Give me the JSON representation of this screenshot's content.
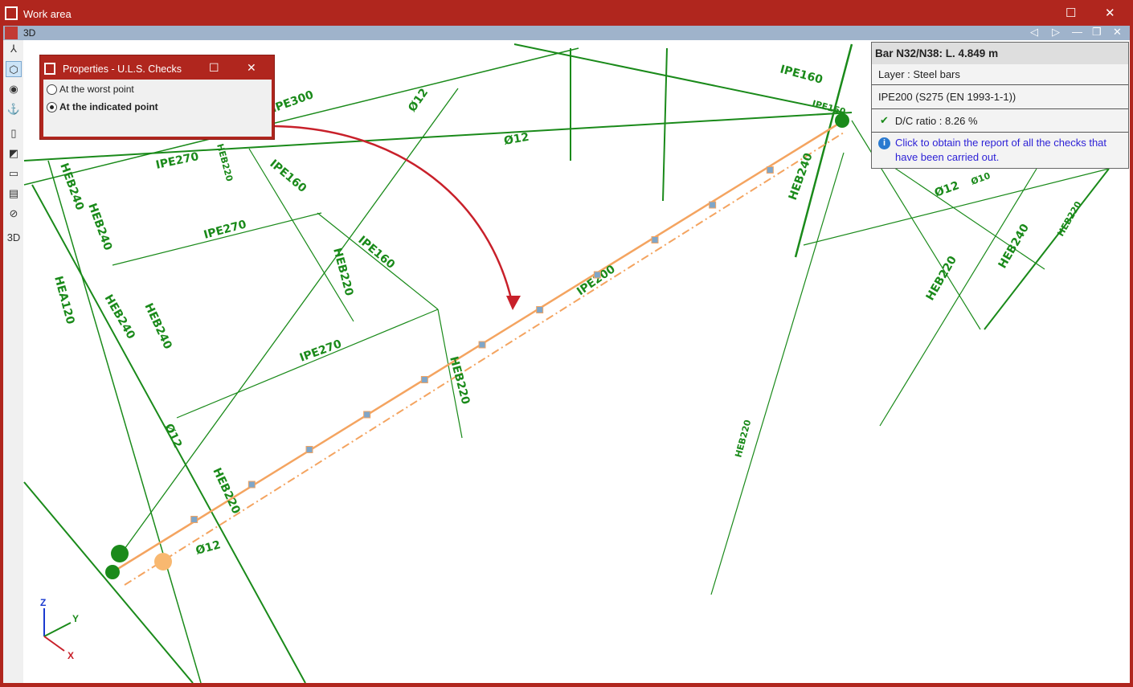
{
  "window": {
    "title": "Work area",
    "maximize": "☐",
    "close": "✕"
  },
  "tab": {
    "name": "3D",
    "prev": "◁",
    "next": "▷",
    "minimize": "—",
    "restore": "❐",
    "close": "✕"
  },
  "toolbar": [
    {
      "icon": "axes-icon",
      "g": "⅄"
    },
    {
      "icon": "cube-view-icon",
      "g": "⬡"
    },
    {
      "icon": "orbit-icon",
      "g": "◉"
    },
    {
      "icon": "rotate-icon",
      "g": "⚓"
    },
    {
      "icon": "section-icon",
      "g": "▯"
    },
    {
      "icon": "plane-icon",
      "g": "◩"
    },
    {
      "icon": "frame-icon",
      "g": "▭"
    },
    {
      "icon": "layers-icon",
      "g": "▤"
    },
    {
      "icon": "hide-icon",
      "g": "⊘"
    },
    {
      "icon": "3d-settings-icon",
      "g": "3D"
    }
  ],
  "properties": {
    "title": "Properties - U.L.S. Checks",
    "options": [
      {
        "label": "At the worst point",
        "selected": false
      },
      {
        "label": "At the indicated point",
        "selected": true
      }
    ]
  },
  "info": {
    "header": "Bar N32/N38: L. 4.849 m",
    "layer": "Layer : Steel bars",
    "profile": "IPE200 (S275 (EN 1993-1-1))",
    "ratio": "D/C ratio : 8.26 %",
    "check_icon": "✔",
    "link": "Click to obtain the report of all the checks that have been carried out.",
    "info_icon": "i"
  },
  "labels": [
    "IPE300",
    "Ø12",
    "Ø12",
    "IPE160",
    "IPE270",
    "IPE270",
    "IPE160",
    "HEB220",
    "IPE270",
    "HEB220",
    "IPE200",
    "HEB240",
    "HEB240",
    "HEB240",
    "HEA120",
    "HEB240",
    "IPE160",
    "Ø12",
    "HEB240",
    "Ø12",
    "HEB220",
    "HEB240",
    "Ø12",
    "HEB220",
    "HEB220",
    "HEB220",
    "IPE160",
    "Ø10",
    "HEB220"
  ],
  "axes": {
    "z": "Z",
    "y": "Y",
    "x": "X"
  },
  "colors": {
    "frame": "#b0261e",
    "green": "#1a8a1a",
    "orange": "#f4a460",
    "arrow": "#c8202a"
  }
}
